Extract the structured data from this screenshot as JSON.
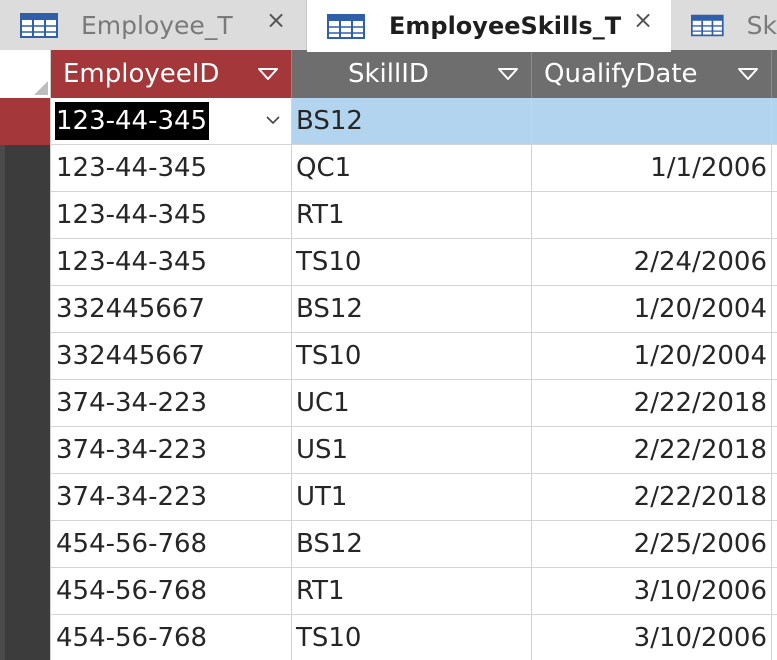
{
  "tabs": [
    {
      "label": "Employee_T",
      "active": false,
      "closable": true,
      "icon": "table-icon"
    },
    {
      "label": "EmployeeSkills_T",
      "active": true,
      "closable": true,
      "icon": "table-icon"
    },
    {
      "label": "Sk",
      "active": false,
      "closable": false,
      "icon": "table-icon"
    }
  ],
  "close_glyph": "×",
  "columns": [
    {
      "label": "EmployeeID",
      "selected": true
    },
    {
      "label": "SkillID",
      "selected": false
    },
    {
      "label": "QualifyDate",
      "selected": false
    }
  ],
  "rows": [
    {
      "employee_id": "123-44-345",
      "skill_id": "BS12",
      "qualify_date": ""
    },
    {
      "employee_id": "123-44-345",
      "skill_id": "QC1",
      "qualify_date": "1/1/2006"
    },
    {
      "employee_id": "123-44-345",
      "skill_id": "RT1",
      "qualify_date": ""
    },
    {
      "employee_id": "123-44-345",
      "skill_id": "TS10",
      "qualify_date": "2/24/2006"
    },
    {
      "employee_id": "332445667",
      "skill_id": "BS12",
      "qualify_date": "1/20/2004"
    },
    {
      "employee_id": "332445667",
      "skill_id": "TS10",
      "qualify_date": "1/20/2004"
    },
    {
      "employee_id": "374-34-223",
      "skill_id": "UC1",
      "qualify_date": "2/22/2018"
    },
    {
      "employee_id": "374-34-223",
      "skill_id": "US1",
      "qualify_date": "2/22/2018"
    },
    {
      "employee_id": "374-34-223",
      "skill_id": "UT1",
      "qualify_date": "2/22/2018"
    },
    {
      "employee_id": "454-56-768",
      "skill_id": "BS12",
      "qualify_date": "2/25/2006"
    },
    {
      "employee_id": "454-56-768",
      "skill_id": "RT1",
      "qualify_date": "3/10/2006"
    },
    {
      "employee_id": "454-56-768",
      "skill_id": "TS10",
      "qualify_date": "3/10/2006"
    }
  ],
  "active_row": 0,
  "colors": {
    "accent": "#a4373a",
    "header_bg": "#6e6e6e",
    "selection_bg": "#b3d4ef",
    "tab_icon": "#2f5fa8"
  }
}
